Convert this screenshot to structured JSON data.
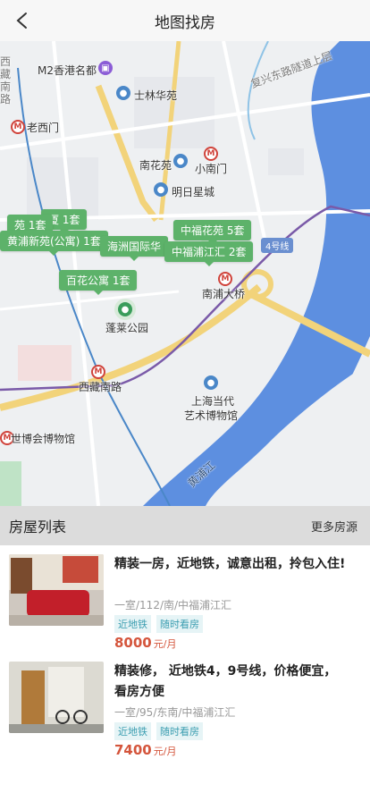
{
  "nav": {
    "title": "地图找房",
    "back_icon": "chevron-left-icon"
  },
  "map": {
    "labels": {
      "m2": "M2香港名都",
      "shilin": "士林华苑",
      "laoximen": "老西门",
      "nanhuayuan": "南花苑",
      "xiaonanmen": "小南门",
      "mingrixingcheng": "明日星城",
      "nanpudaqiao": "南浦大桥",
      "penglai": "蓬莱公园",
      "xizangnanlu": "西藏南路",
      "museum1": "上海当代",
      "museum2": "艺术博物馆",
      "shibohui": "世博会博物馆",
      "huangpujiang": "黄浦江",
      "fuxing": "复兴东路隧道上层",
      "road_left1": "西",
      "road_left2": "藏",
      "road_left3": "南",
      "road_left4": "路",
      "line4": "4号线"
    },
    "bubbles": [
      {
        "text": "厦 1套"
      },
      {
        "text": "苑 1套"
      },
      {
        "text": "黄浦新苑(公寓) 1套"
      },
      {
        "text": "海洲国际华"
      },
      {
        "text": "中福花苑 5套"
      },
      {
        "text": "中福浦江汇 2套"
      },
      {
        "text": "百花公寓 1套"
      }
    ]
  },
  "list": {
    "title": "房屋列表",
    "more": "更多房源",
    "items": [
      {
        "title": "精装一房，近地铁，诚意出租，拎包入住!",
        "meta": "一室/112/南/中福浦江汇",
        "tags": [
          "近地铁",
          "随时看房"
        ],
        "price": "8000",
        "unit": "元/月"
      },
      {
        "title": "精装修， 近地铁4，9号线，价格便宜，看房方便",
        "meta": "一室/95/东南/中福浦江汇",
        "tags": [
          "近地铁",
          "随时看房"
        ],
        "price": "7400",
        "unit": "元/月"
      }
    ]
  },
  "colors": {
    "accent_green": "#5db26a",
    "price": "#d4553c",
    "tag_text": "#3b9db0",
    "river": "#5d8fe0"
  }
}
